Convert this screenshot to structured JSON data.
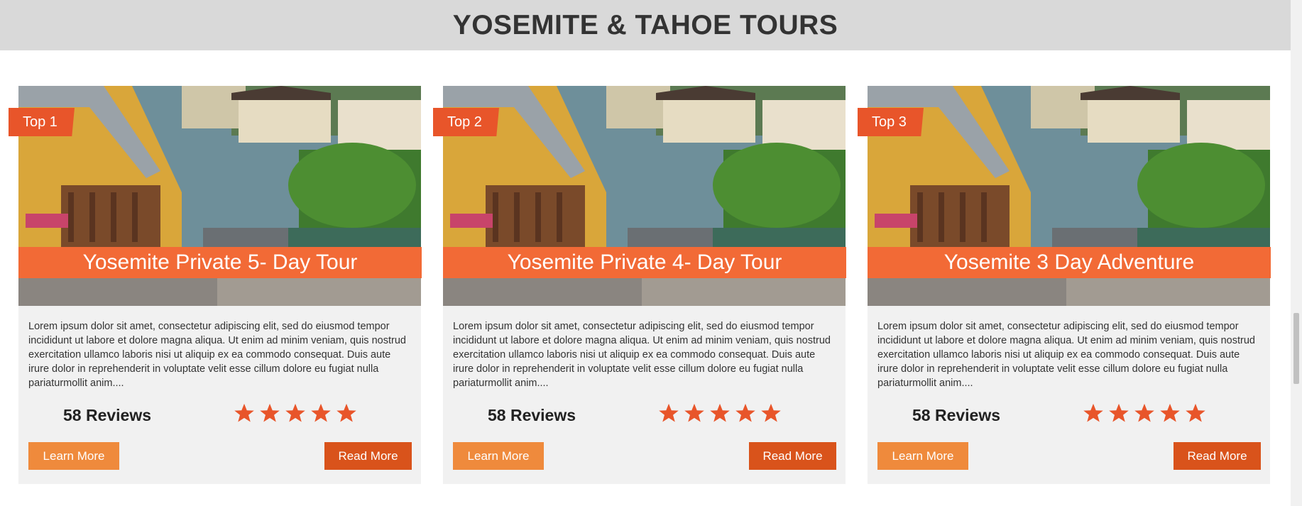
{
  "page": {
    "title": "YOSEMITE & TAHOE TOURS"
  },
  "colors": {
    "accent": "#f26a36",
    "ribbon": "#e8552a",
    "learn_button": "#ef8a3c",
    "read_button": "#d9531b",
    "star": "#e8552a",
    "header_band": "#d9d9d9"
  },
  "cards": [
    {
      "badge": "Top 1",
      "title": "Yosemite Private 5- Day Tour",
      "description": "Lorem ipsum dolor sit amet, consectetur adipiscing elit, sed do eiusmod tempor incididunt ut labore et dolore magna aliqua. Ut enim ad minim veniam, quis nostrud exercitation ullamco laboris nisi ut aliquip ex ea commodo consequat. Duis aute irure dolor in reprehenderit in voluptate velit esse cillum dolore eu fugiat nulla pariaturmollit anim....",
      "reviews": "58 Reviews",
      "rating": 5,
      "learn_label": "Learn More",
      "read_label": "Read More"
    },
    {
      "badge": "Top 2",
      "title": "Yosemite Private 4- Day Tour",
      "description": "Lorem ipsum dolor sit amet, consectetur adipiscing elit, sed do eiusmod tempor incididunt ut labore et dolore magna aliqua. Ut enim ad minim veniam, quis nostrud exercitation ullamco laboris nisi ut aliquip ex ea commodo consequat. Duis aute irure dolor in reprehenderit in voluptate velit esse cillum dolore eu fugiat nulla pariaturmollit anim....",
      "reviews": "58 Reviews",
      "rating": 5,
      "learn_label": "Learn More",
      "read_label": "Read More"
    },
    {
      "badge": "Top 3",
      "title": "Yosemite 3 Day Adventure",
      "description": "Lorem ipsum dolor sit amet, consectetur adipiscing elit, sed do eiusmod tempor incididunt ut labore et dolore magna aliqua. Ut enim ad minim veniam, quis nostrud exercitation ullamco laboris nisi ut aliquip ex ea commodo consequat. Duis aute irure dolor in reprehenderit in voluptate velit esse cillum dolore eu fugiat nulla pariaturmollit anim....",
      "reviews": "58 Reviews",
      "rating": 5,
      "learn_label": "Learn More",
      "read_label": "Read More"
    }
  ]
}
